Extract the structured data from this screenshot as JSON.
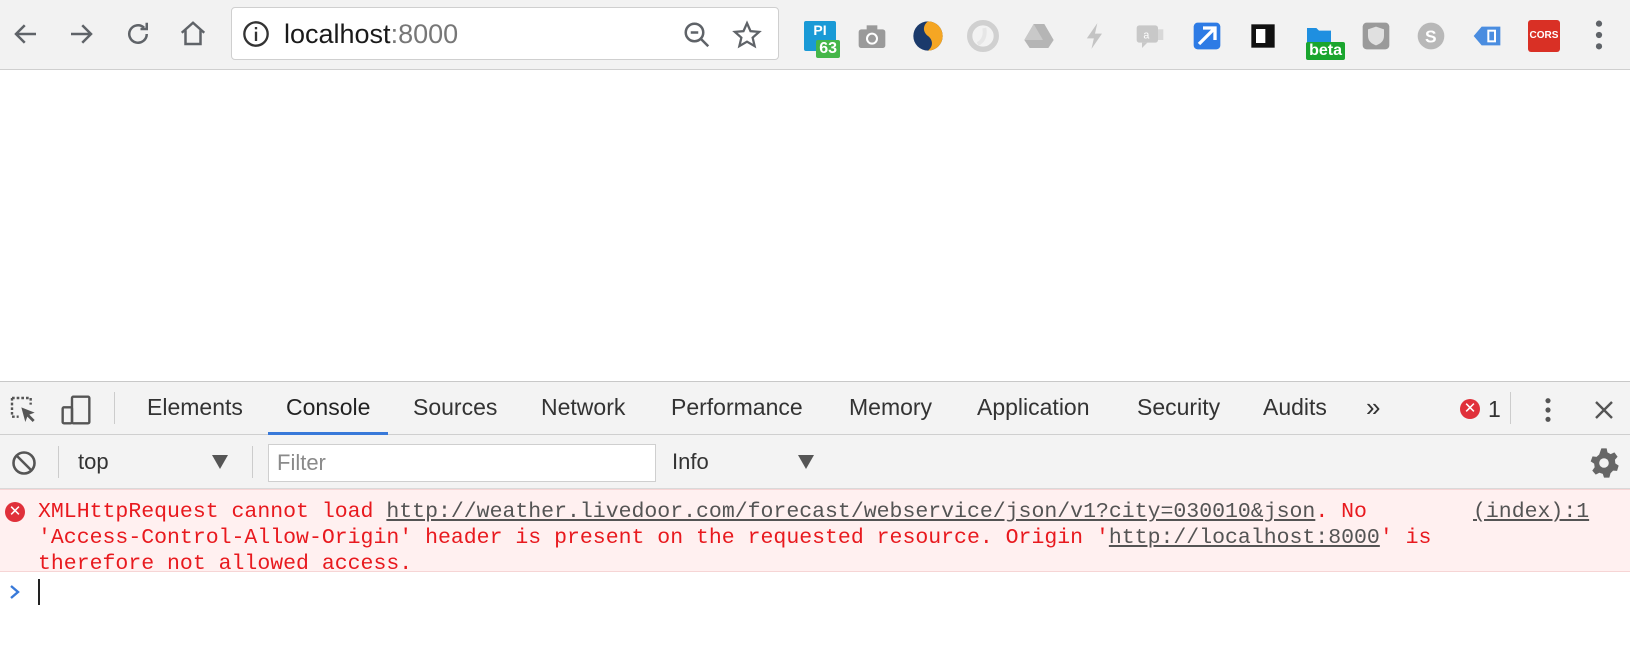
{
  "browser": {
    "url_host": "localhost",
    "url_port": ":8000",
    "extensions": [
      {
        "name": "pi-ext",
        "label": "PI",
        "badge": "63",
        "color": "#1a9ad6",
        "badge_color": "#45b649"
      },
      {
        "name": "camera-ext",
        "color": "#9a9a9a"
      },
      {
        "name": "s-swirl-ext",
        "color": "#1b3a6b"
      },
      {
        "name": "gray-circle-ext",
        "color": "#d0d0d0"
      },
      {
        "name": "drive-ext",
        "color": "#b5b5b5"
      },
      {
        "name": "bolt-ext",
        "color": "#c4c4c4"
      },
      {
        "name": "chat-ext",
        "color": "#c8c8c8"
      },
      {
        "name": "blue-arrow-ext",
        "color": "#2d7be5"
      },
      {
        "name": "black-square-ext",
        "color": "#111111"
      },
      {
        "name": "beta-ext",
        "badge": "beta",
        "color": "#1f8fe0",
        "badge_color": "#1aa52e"
      },
      {
        "name": "shield-ext",
        "color": "#9a9a9a"
      },
      {
        "name": "skype-ext",
        "color": "#b8b8b8"
      },
      {
        "name": "tag-ext",
        "color": "#4a8de0"
      },
      {
        "name": "cors-ext",
        "label": "CORS",
        "color": "#d93025"
      }
    ]
  },
  "devtools": {
    "tabs": [
      "Elements",
      "Console",
      "Sources",
      "Network",
      "Performance",
      "Memory",
      "Application",
      "Security",
      "Audits"
    ],
    "active_tab": "Console",
    "more_tabs": "»",
    "error_count": "1",
    "context": "top",
    "filter_placeholder": "Filter",
    "level": "Info",
    "message": {
      "part1": "XMLHttpRequest cannot load ",
      "link1": "http://weather.livedoor.com/forecast/webservice/json/v1?city=030010&json",
      "part2": ". No\n'Access-Control-Allow-Origin' header is present on the requested resource. Origin '",
      "link2": "http://localhost:8000",
      "part3": "' is\ntherefore not allowed access.",
      "source": "(index):1"
    },
    "accent_color": "#3879d9",
    "error_color": "#e8191e"
  }
}
